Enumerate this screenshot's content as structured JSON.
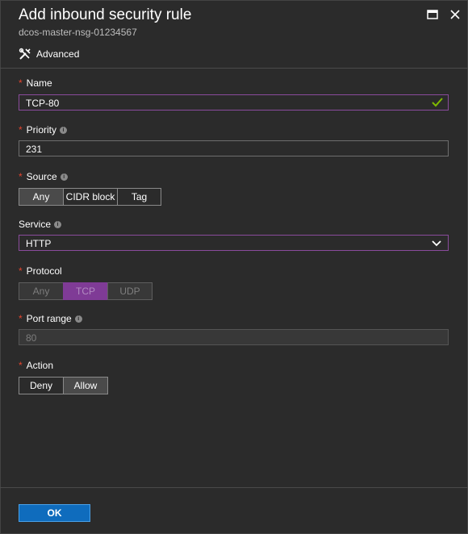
{
  "header": {
    "title": "Add inbound security rule",
    "subtitle": "dcos-master-nsg-01234567",
    "advanced_label": "Advanced"
  },
  "form": {
    "name": {
      "label": "Name",
      "value": "TCP-80",
      "required": true
    },
    "priority": {
      "label": "Priority",
      "value": "231",
      "required": true
    },
    "source": {
      "label": "Source",
      "options": [
        "Any",
        "CIDR block",
        "Tag"
      ],
      "selected": "Any",
      "required": true
    },
    "service": {
      "label": "Service",
      "value": "HTTP"
    },
    "protocol": {
      "label": "Protocol",
      "options": [
        "Any",
        "TCP",
        "UDP"
      ],
      "selected": "TCP",
      "required": true,
      "disabled": true
    },
    "port_range": {
      "label": "Port range",
      "value": "80",
      "required": true,
      "disabled": true
    },
    "action": {
      "label": "Action",
      "options": [
        "Deny",
        "Allow"
      ],
      "selected": "Allow",
      "required": true
    }
  },
  "footer": {
    "ok_label": "OK"
  },
  "colors": {
    "accent_purple": "#8a4b9c",
    "required_red": "#e3442e",
    "ok_blue": "#0f6cbd",
    "check_green": "#7fba00"
  },
  "required_marker": "*",
  "info_glyph": "i"
}
